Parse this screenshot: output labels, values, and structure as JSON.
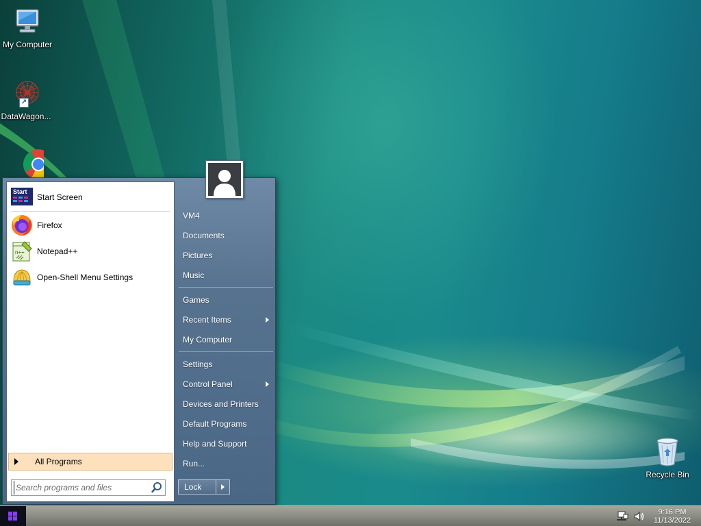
{
  "desktop": {
    "icons": [
      {
        "label": "My Computer"
      },
      {
        "label": "DataWagon..."
      },
      {
        "label": ""
      },
      {
        "label": "Recycle Bin"
      }
    ]
  },
  "start_menu": {
    "pinned": [
      {
        "label": "Start Screen",
        "icon_text": "Start"
      },
      {
        "label": "Firefox"
      },
      {
        "label": "Notepad++",
        "icon_text": "n++"
      },
      {
        "label": "Open-Shell Menu Settings"
      }
    ],
    "all_programs_label": "All Programs",
    "search": {
      "placeholder": "Search programs and files",
      "value": ""
    },
    "right_items": [
      {
        "label": "VM4",
        "has_submenu": false
      },
      {
        "label": "Documents",
        "has_submenu": false
      },
      {
        "label": "Pictures",
        "has_submenu": false
      },
      {
        "label": "Music",
        "has_submenu": false
      },
      {
        "label": "Games",
        "has_submenu": false
      },
      {
        "label": "Recent Items",
        "has_submenu": true
      },
      {
        "label": "My Computer",
        "has_submenu": false
      },
      {
        "label": "Settings",
        "has_submenu": false
      },
      {
        "label": "Control Panel",
        "has_submenu": true
      },
      {
        "label": "Devices and Printers",
        "has_submenu": false
      },
      {
        "label": "Default Programs",
        "has_submenu": false
      },
      {
        "label": "Help and Support",
        "has_submenu": false
      },
      {
        "label": "Run...",
        "has_submenu": false
      }
    ],
    "lock_label": "Lock"
  },
  "taskbar": {
    "clock_time": "9:16 PM",
    "clock_date": "11/13/2022"
  },
  "colors": {
    "menu_right_pane": "#56728f",
    "all_programs_highlight": "#fde1bd",
    "taskbar": "#8e8f86",
    "start_button": "#0c0f18"
  },
  "icons": {
    "my_computer": "computer-icon",
    "datawagon": "datawagon-icon",
    "chrome": "chrome-icon",
    "recycle_bin": "recycle-bin-icon",
    "start_screen": "start-screen-icon",
    "firefox": "firefox-icon",
    "notepadpp": "notepadpp-icon",
    "open_shell": "open-shell-icon",
    "search": "search-icon",
    "user": "user-icon",
    "network": "network-icon",
    "volume": "volume-icon",
    "windows_logo": "windows-logo-icon"
  }
}
